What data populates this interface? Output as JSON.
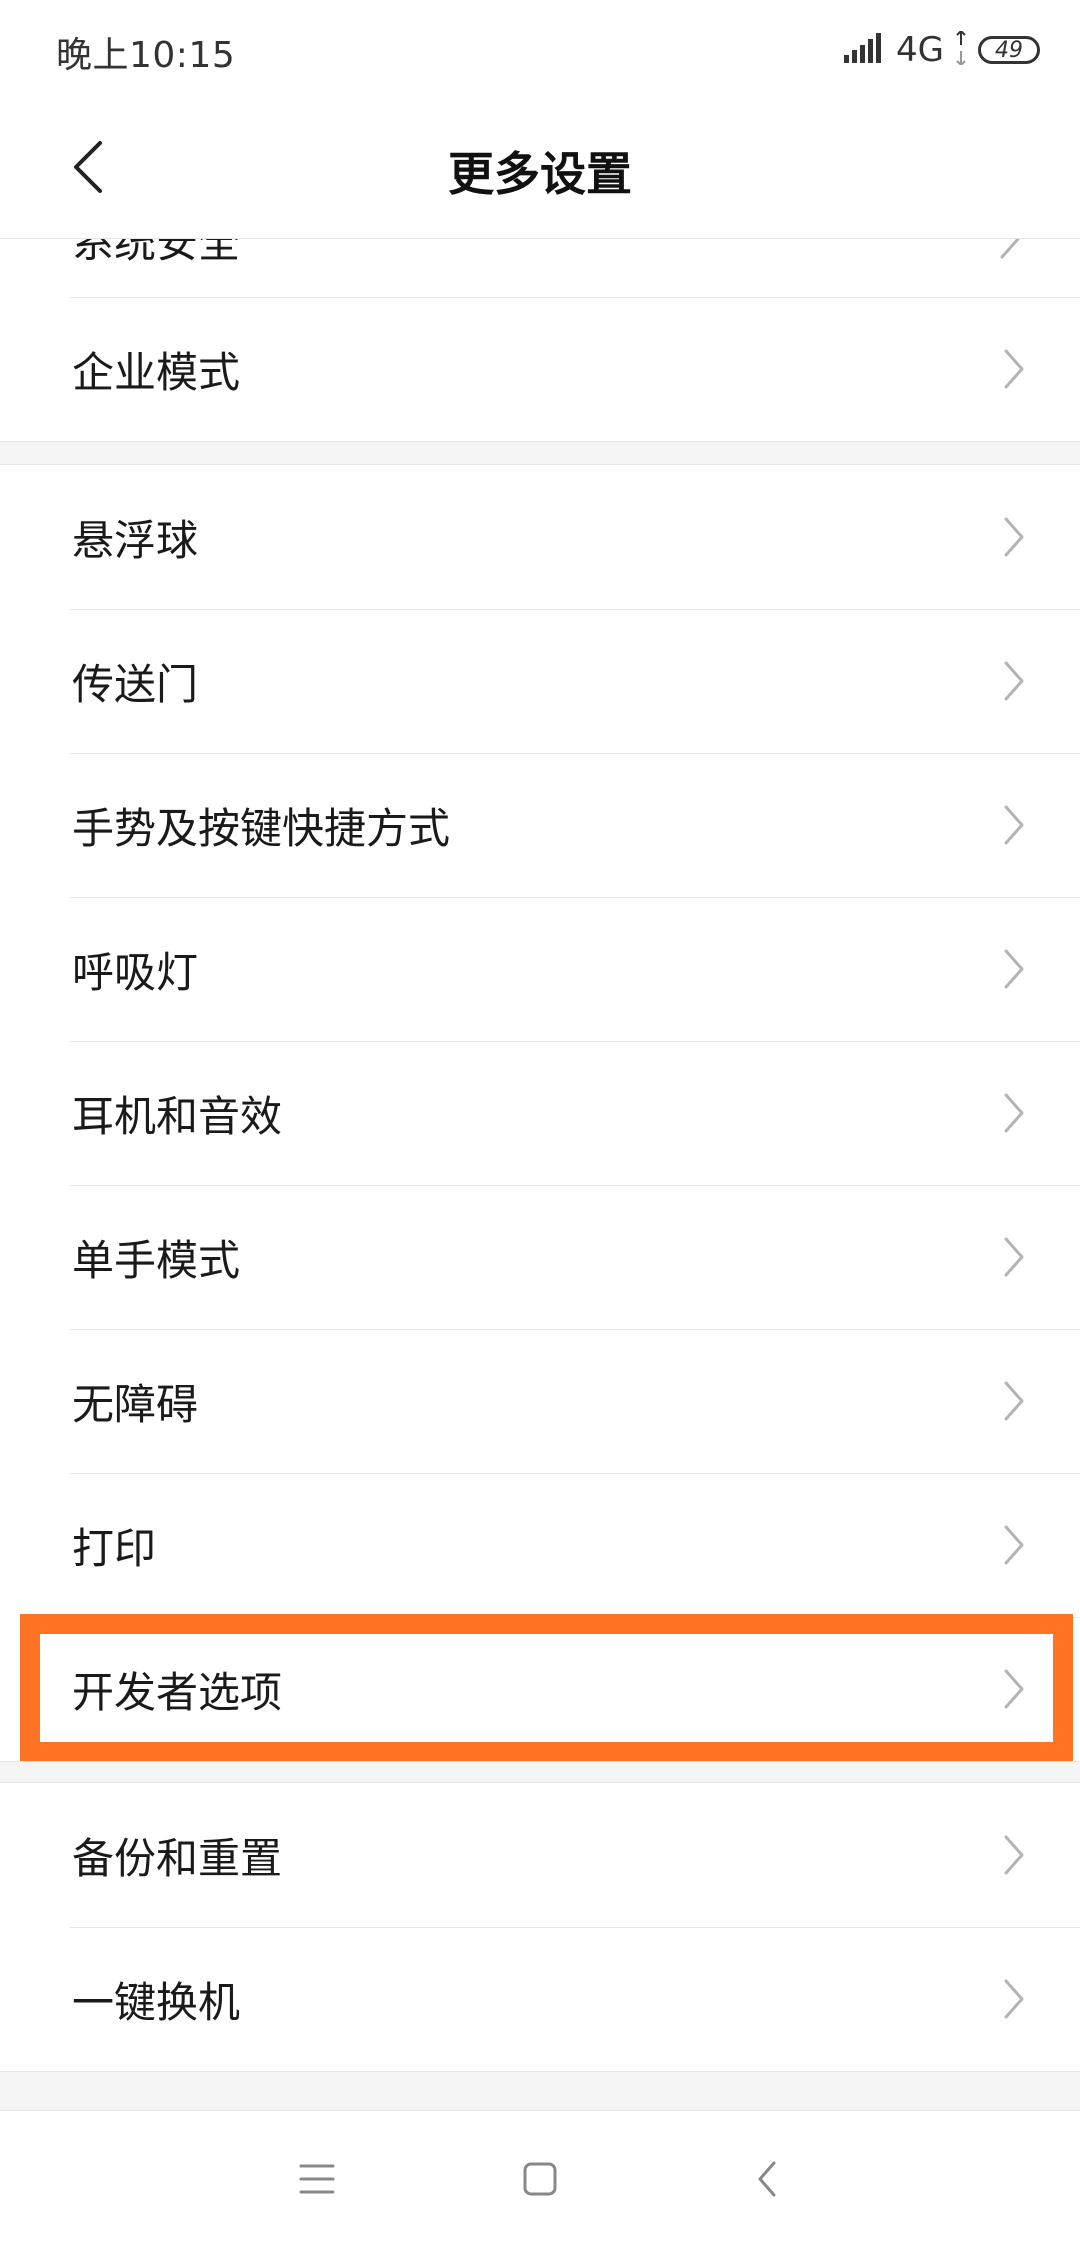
{
  "status_bar": {
    "time": "晚上10:15",
    "network": "4G",
    "battery": "49"
  },
  "header": {
    "title": "更多设置",
    "back_icon": "chevron-left-icon"
  },
  "partial_item": {
    "label": "系统安全"
  },
  "section_top": {
    "items": [
      {
        "label": "企业模式"
      }
    ]
  },
  "section_main": {
    "items": [
      {
        "label": "悬浮球"
      },
      {
        "label": "传送门"
      },
      {
        "label": "手势及按键快捷方式"
      },
      {
        "label": "呼吸灯"
      },
      {
        "label": "耳机和音效"
      },
      {
        "label": "单手模式"
      },
      {
        "label": "无障碍"
      },
      {
        "label": "打印"
      },
      {
        "label": "开发者选项"
      }
    ]
  },
  "section_bottom": {
    "items": [
      {
        "label": "备份和重置"
      },
      {
        "label": "一键换机"
      }
    ]
  },
  "nav": {
    "menu_icon": "menu-icon",
    "home_icon": "home-icon",
    "back_icon": "back-icon"
  },
  "colors": {
    "highlight": "#ff7324",
    "divider": "#e6e6e6",
    "gap": "#f5f5f5"
  }
}
